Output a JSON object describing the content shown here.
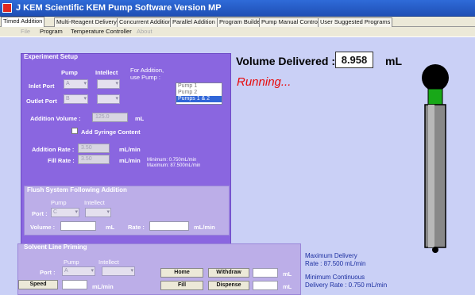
{
  "window": {
    "title": "J KEM Scientific KEM Pump Software   Version MP"
  },
  "tabs": [
    "Timed Addition",
    "Multi-Reagent Delivery",
    "Concurrent Addition",
    "Parallel Addition",
    "Program Builder",
    "Pump Manual Control",
    "User Suggested Programs"
  ],
  "menu": [
    "File",
    "Program",
    "Temperature Controller",
    "About"
  ],
  "experiment": {
    "title": "Experiment Setup",
    "pump_header": "Pump",
    "intellect_header": "Intellect",
    "for_addition": "For Addition,\nuse Pump :",
    "inlet_label": "Inlet Port",
    "inlet_value": "A",
    "outlet_label": "Outlet Port",
    "outlet_value": "B",
    "pump_options": [
      "Pump 1",
      "Pump 2",
      "Pumps 1 & 2"
    ],
    "pump_selected": "Pumps 1 & 2",
    "addition_volume_label": "Addition Volume :",
    "addition_volume_value": "125.0",
    "addition_volume_unit": "mL",
    "syringe_label": "Add Syringe Content",
    "addition_rate_label": "Addition Rate :",
    "addition_rate_value": "3.50",
    "addition_rate_unit": "mL/min",
    "fill_rate_label": "Fill Rate :",
    "fill_rate_value": "3.50",
    "fill_rate_unit": "mL/min",
    "minimum": "Minimum: 0.750mL/min",
    "maximum": "Maximum: 87.500mL/min"
  },
  "flush": {
    "title": "Flush System Following Addition",
    "pump_header": "Pump",
    "intellect_header": "Intellect",
    "port_label": "Port :",
    "port_value": "C",
    "volume_label": "Volume :",
    "volume_unit": "mL",
    "rate_label": "Rate :",
    "rate_unit": "mL/min"
  },
  "solvent": {
    "title": "Solvent Line Priming",
    "pump_header": "Pump",
    "intellect_header": "Intellect",
    "port_label": "Port :",
    "port_value": "A",
    "speed_label": "Speed",
    "speed_unit": "mL/min",
    "home": "Home",
    "fill": "Fill",
    "withdraw": "Withdraw",
    "dispense": "Dispense",
    "ml1": "mL",
    "ml2": "mL"
  },
  "status": {
    "volume_label": "Volume Delivered :",
    "volume_value": "8.958",
    "volume_unit": "mL",
    "running": "Running..."
  },
  "info": {
    "max_line1": "Maximum Delivery",
    "max_line2": "Rate : 87.500 mL/min",
    "min_line1": "Minimum Continuous",
    "min_line2": "Delivery Rate : 0.750 mL/min"
  },
  "syringe": {
    "level": 0.0
  }
}
